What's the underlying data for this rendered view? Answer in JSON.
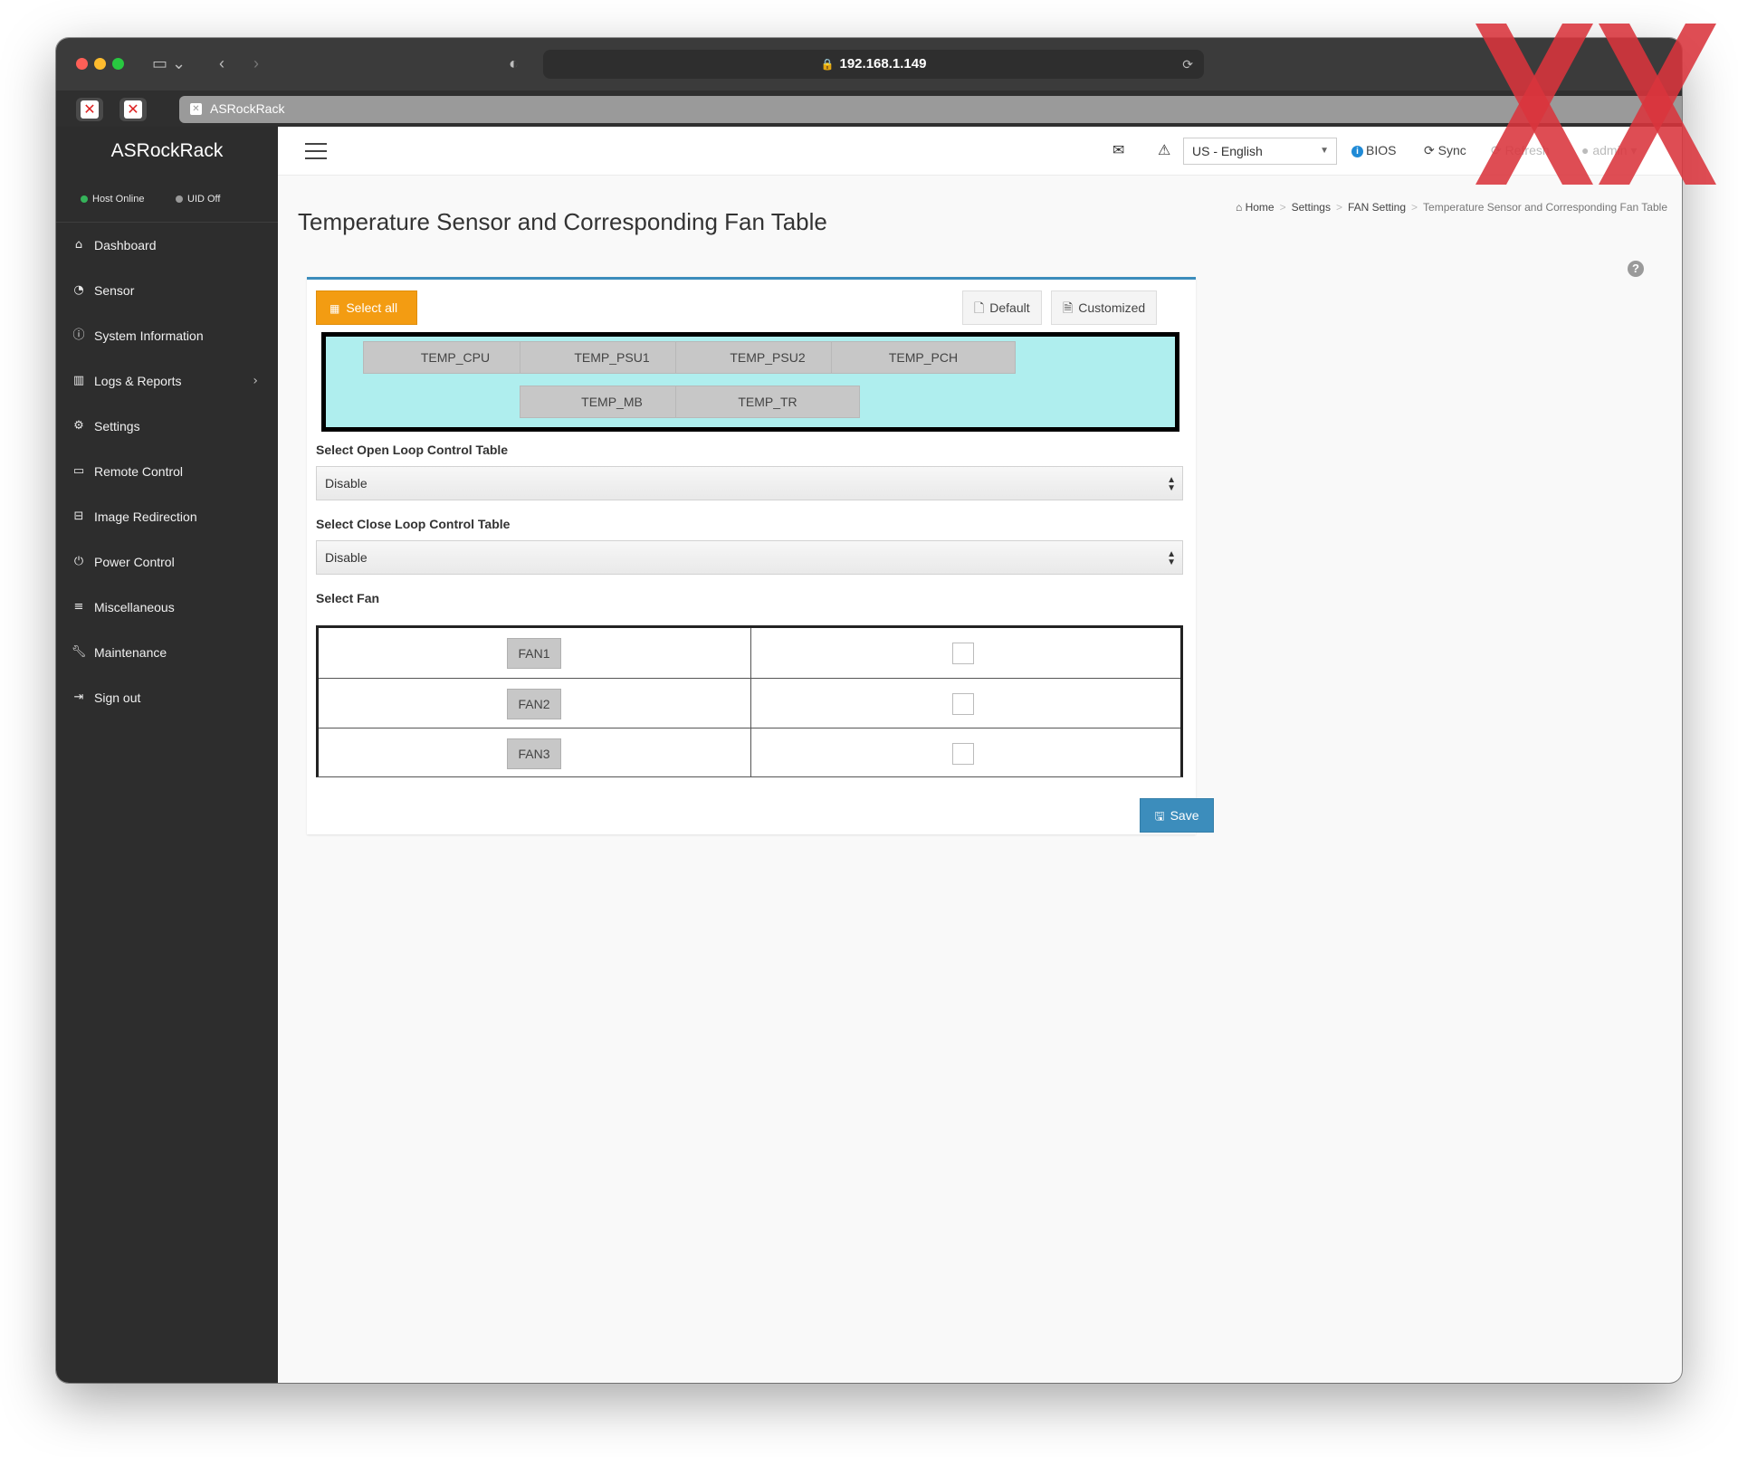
{
  "browser": {
    "address": "192.168.1.149",
    "tab_title": "ASRockRack"
  },
  "sidebar": {
    "brand": "ASRockRack",
    "host_status": "Host Online",
    "uid_status": "UID Off",
    "items": [
      {
        "label": "Dashboard",
        "icon": "home-icon"
      },
      {
        "label": "Sensor",
        "icon": "dashboard-gauge-icon"
      },
      {
        "label": "System Information",
        "icon": "info-circle-icon"
      },
      {
        "label": "Logs & Reports",
        "icon": "bar-chart-icon"
      },
      {
        "label": "Settings",
        "icon": "gear-icon"
      },
      {
        "label": "Remote Control",
        "icon": "monitor-icon"
      },
      {
        "label": "Image Redirection",
        "icon": "drive-icon"
      },
      {
        "label": "Power Control",
        "icon": "power-icon"
      },
      {
        "label": "Miscellaneous",
        "icon": "list-icon"
      },
      {
        "label": "Maintenance",
        "icon": "wrench-icon"
      },
      {
        "label": "Sign out",
        "icon": "sign-out-icon"
      }
    ]
  },
  "header": {
    "language": "US - English",
    "bios": "BIOS",
    "sync": "Sync",
    "refresh": "Refresh",
    "user": "admin"
  },
  "breadcrumb": {
    "home": "Home",
    "settings": "Settings",
    "fan_setting": "FAN Setting",
    "current": "Temperature Sensor and Corresponding Fan Table"
  },
  "page": {
    "title": "Temperature Sensor and Corresponding Fan Table",
    "select_all": "Select all",
    "default": "Default",
    "customized": "Customized",
    "sensors": [
      "TEMP_CPU",
      "TEMP_PSU1",
      "TEMP_PSU2",
      "TEMP_PCH",
      "TEMP_MB",
      "TEMP_TR"
    ],
    "open_loop_label": "Select Open Loop Control Table",
    "open_loop_value": "Disable",
    "close_loop_label": "Select Close Loop Control Table",
    "close_loop_value": "Disable",
    "select_fan_label": "Select Fan",
    "fans": [
      {
        "name": "FAN1",
        "checked": false
      },
      {
        "name": "FAN2",
        "checked": false
      },
      {
        "name": "FAN3",
        "checked": false
      }
    ],
    "save": "Save"
  },
  "colors": {
    "sidebar_bg": "#2d2d2d",
    "primary": "#3c8dbc",
    "orange": "#f39c12",
    "sensor_area": "#afeeee",
    "watermark": "#d9343c"
  }
}
